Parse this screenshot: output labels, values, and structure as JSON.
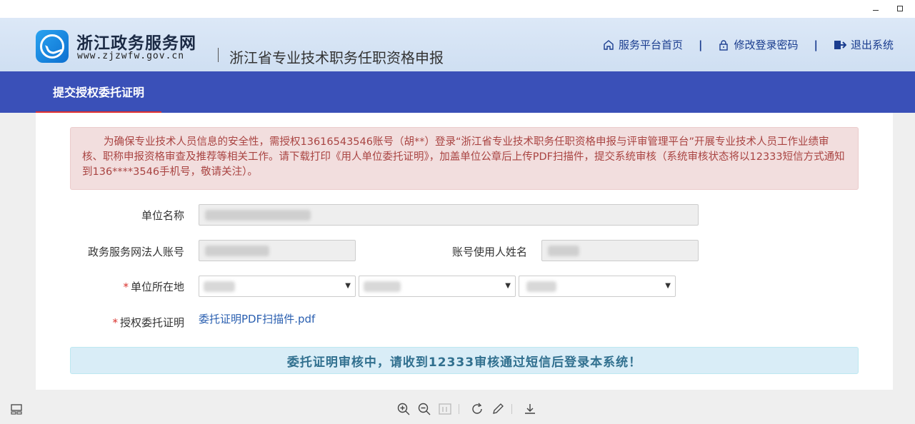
{
  "header": {
    "brand_name": "浙江政务服务网",
    "brand_url": "www.zjzwfw.gov.cn",
    "system_title": "浙江省专业技术职务任职资格申报",
    "links": {
      "home": "服务平台首页",
      "change_password": "修改登录密码",
      "logout": "退出系统",
      "separator": "|"
    }
  },
  "nav": {
    "active_tab": "提交授权委托证明"
  },
  "alert": {
    "text": "为确保专业技术人员信息的安全性，需授权13616543546账号（胡**）登录“浙江省专业技术职务任职资格申报与评审管理平台”开展专业技术人员工作业绩审核、职称申报资格审查及推荐等相关工作。请下载打印《用人单位委托证明》，加盖单位公章后上传PDF扫描件，提交系统审核（系统审核状态将以12333短信方式通知到136****3546手机号，敬请关注）。"
  },
  "form": {
    "unit_name_label": "单位名称",
    "legal_account_label": "政务服务网法人账号",
    "account_user_label": "账号使用人姓名",
    "location_label": "单位所在地",
    "authorization_label": "授权委托证明",
    "required_mark": "*",
    "authorization_file": "委托证明PDF扫描件.pdf",
    "select_arrow": "▼"
  },
  "notice": {
    "text": "委托证明审核中，请收到12333审核通过短信后登录本系统！"
  },
  "colors": {
    "nav_bg": "#3a50b8",
    "alert_text": "#a94442",
    "notice_text": "#31708f",
    "link": "#2a5fb0"
  }
}
